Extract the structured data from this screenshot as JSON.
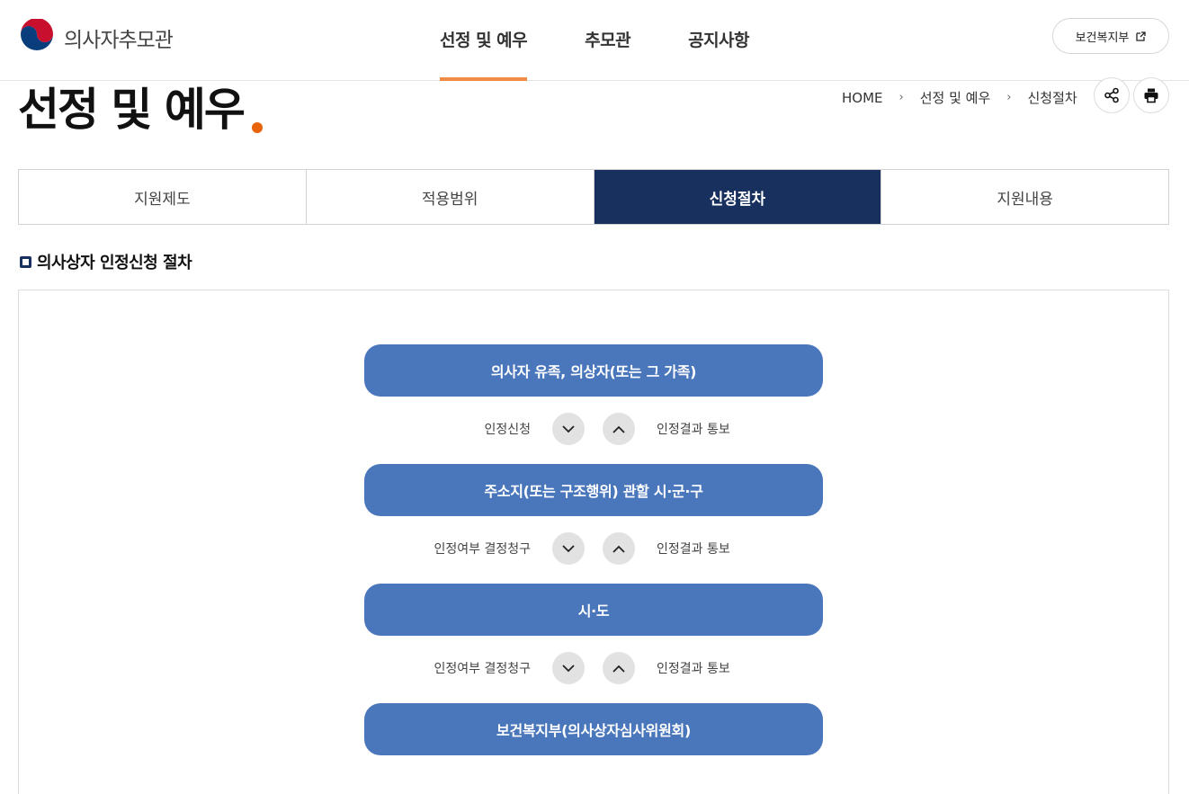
{
  "header": {
    "logo_text": "의사자추모관",
    "nav": [
      "선정 및 예우",
      "추모관",
      "공지사항"
    ],
    "external_link": "보건복지부"
  },
  "page": {
    "title": "선정 및 예우",
    "breadcrumb": [
      "HOME",
      "선정 및 예우",
      "신청절차"
    ],
    "breadcrumb_sep": "›"
  },
  "tabs": [
    {
      "label": "지원제도",
      "active": false
    },
    {
      "label": "적용범위",
      "active": false
    },
    {
      "label": "신청절차",
      "active": true
    },
    {
      "label": "지원내용",
      "active": false
    }
  ],
  "section": {
    "title": "의사상자 인정신청 절차"
  },
  "flow": {
    "steps": [
      "의사자 유족, 의상자(또는 그 가족)",
      "주소지(또는 구조행위) 관할 시·군·구",
      "시·도",
      "보건복지부(의사상자심사위원회)"
    ],
    "connectors": [
      {
        "down": "인정신청",
        "up": "인정결과 통보"
      },
      {
        "down": "인정여부 결정청구",
        "up": "인정결과 통보"
      },
      {
        "down": "인정여부 결정청구",
        "up": "인정결과 통보"
      }
    ]
  },
  "colors": {
    "nav_active_underline": "#f08a46",
    "title_dot": "#e8630a",
    "tab_active_bg": "#17305e",
    "step_bg": "#4a77bb",
    "arrow_bg": "#e2e2e2"
  }
}
